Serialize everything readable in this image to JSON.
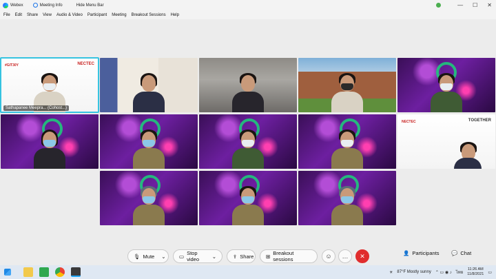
{
  "titlebar": {
    "app_name": "Webex",
    "meeting_info": "Meeting Info",
    "hide_menu": "Hide Menu Bar"
  },
  "menu": [
    "File",
    "Edit",
    "Share",
    "View",
    "Audio & Video",
    "Participant",
    "Meeting",
    "Breakout Sessions",
    "Help"
  ],
  "tiles": [
    {
      "name": "Sathapanee Meepra... (Cohost...)",
      "kind": "presenter"
    },
    {
      "name": "",
      "kind": "room"
    },
    {
      "name": "",
      "kind": "gray"
    },
    {
      "name": "",
      "kind": "temple"
    },
    {
      "name": "",
      "kind": "purple"
    },
    {
      "name": "",
      "kind": "purple"
    },
    {
      "name": "",
      "kind": "purple"
    },
    {
      "name": "",
      "kind": "purple"
    },
    {
      "name": "",
      "kind": "purple"
    },
    {
      "name": "",
      "kind": "slide"
    },
    {
      "name": "",
      "kind": "purple"
    },
    {
      "name": "",
      "kind": "purple"
    },
    {
      "name": "",
      "kind": "purple"
    }
  ],
  "slide": {
    "brand_left": "#GIT30Y",
    "brand_right": "NECTEC",
    "together": "TOGETHER"
  },
  "controls": {
    "mute": "Mute",
    "stop_video": "Stop video",
    "share": "Share",
    "breakout": "Breakout sessions",
    "participants": "Participants",
    "chat": "Chat"
  },
  "taskbar": {
    "weather": "87°F  Mostly sunny",
    "lang": "ไทย",
    "time": "11:26 AM",
    "date": "11/8/2021"
  },
  "colors": {
    "active_border": "#35c3e0",
    "leave": "#e02d2d"
  }
}
